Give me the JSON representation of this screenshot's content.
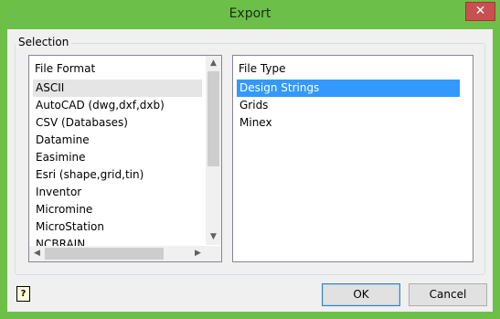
{
  "window": {
    "title": "Export",
    "close_glyph": "✕"
  },
  "selection": {
    "group_label": "Selection",
    "file_format": {
      "header": "File Format",
      "items": [
        "ASCII",
        "AutoCAD (dwg,dxf,dxb)",
        "CSV (Databases)",
        "Datamine",
        "Easimine",
        "Esri (shape,grid,tin)",
        "Inventor",
        "Micromine",
        "MicroStation",
        "NCBRAIN"
      ],
      "selected": "ASCII"
    },
    "file_type": {
      "header": "File Type",
      "items": [
        "Design Strings",
        "Grids",
        "Minex"
      ],
      "selected": "Design Strings"
    }
  },
  "buttons": {
    "ok": "OK",
    "cancel": "Cancel",
    "help_glyph": "?"
  },
  "icons": {
    "help": "help-icon",
    "close": "close-icon",
    "up": "chevron-up-icon",
    "down": "chevron-down-icon",
    "left": "chevron-left-icon",
    "right": "chevron-right-icon"
  },
  "colors": {
    "title_bar": "#6cc04a",
    "selection_blue": "#3399ff"
  }
}
